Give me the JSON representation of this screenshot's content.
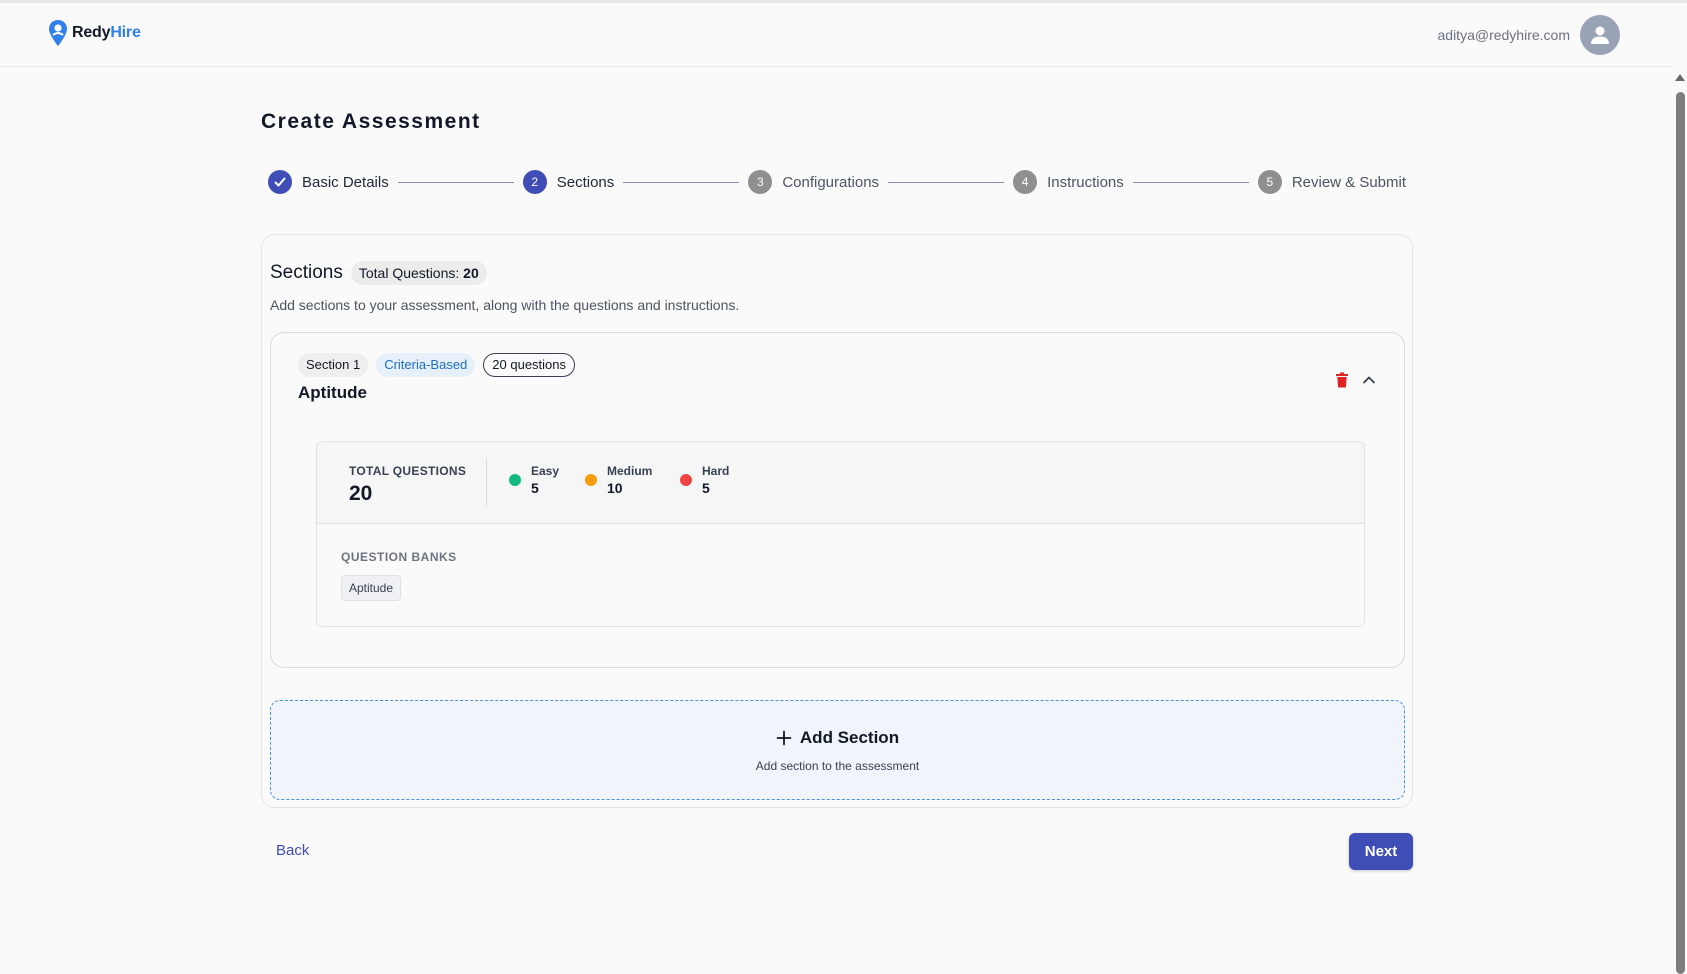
{
  "header": {
    "brand_first": "Redy",
    "brand_second": "Hire",
    "user_email": "aditya@redyhire.com",
    "brand_color": "#2f80ed"
  },
  "page": {
    "title": "Create Assessment"
  },
  "stepper": {
    "steps": [
      {
        "label": "Basic Details",
        "status": "done",
        "number": "1"
      },
      {
        "label": "Sections",
        "status": "active",
        "number": "2"
      },
      {
        "label": "Configurations",
        "status": "todo",
        "number": "3"
      },
      {
        "label": "Instructions",
        "status": "todo",
        "number": "4"
      },
      {
        "label": "Review & Submit",
        "status": "todo",
        "number": "5"
      }
    ],
    "active_color": "#3f4db6",
    "todo_color": "#8f8f8f"
  },
  "sections": {
    "title": "Sections",
    "total_label": "Total Questions:",
    "total_value": "20",
    "description": "Add sections to your assessment, along with the questions and instructions.",
    "items": [
      {
        "index_label": "Section 1",
        "type_label": "Criteria-Based",
        "count_label": "20 questions",
        "name": "Aptitude",
        "total_questions_label": "TOTAL QUESTIONS",
        "total_questions": "20",
        "difficulty": [
          {
            "label": "Easy",
            "count": "5",
            "color": "#10b981"
          },
          {
            "label": "Medium",
            "count": "10",
            "color": "#f59e0b"
          },
          {
            "label": "Hard",
            "count": "5",
            "color": "#ef4444"
          }
        ],
        "question_banks_label": "QUESTION BANKS",
        "question_banks": [
          "Aptitude"
        ]
      }
    ],
    "add_section": {
      "title": "Add Section",
      "subtitle": "Add section to the assessment"
    }
  },
  "footer": {
    "back_label": "Back",
    "next_label": "Next"
  }
}
